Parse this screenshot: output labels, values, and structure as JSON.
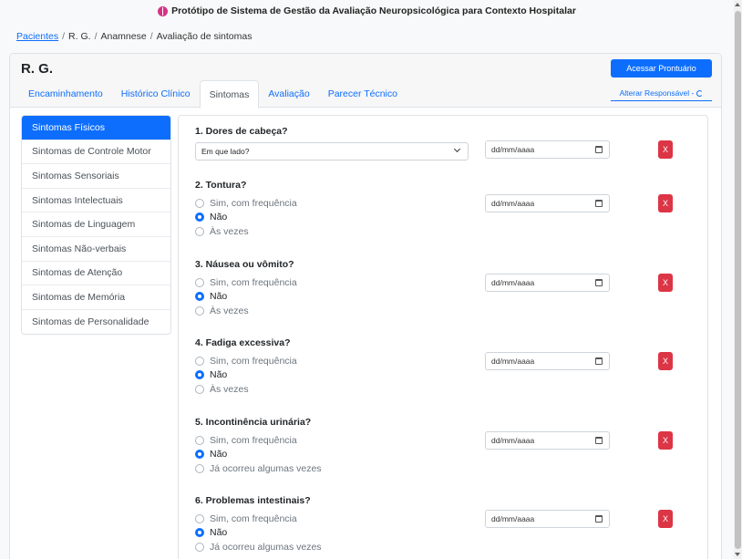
{
  "app": {
    "title": "Protótipo de Sistema de Gestão da Avaliação Neuropsicológica para Contexto Hospitalar"
  },
  "breadcrumb": {
    "items": [
      "Pacientes",
      "R. G.",
      "Anamnese",
      "Avaliação de sintomas"
    ]
  },
  "patient": {
    "name": "R. G."
  },
  "header": {
    "primary_button": "Acessar Prontuário",
    "alter_link": "Alterar Responsável -"
  },
  "tabs": [
    "Encaminhamento",
    "Histórico Clínico",
    "Sintomas",
    "Avaliação",
    "Parecer Técnico"
  ],
  "active_tab": "Sintomas",
  "sidebar": {
    "items": [
      "Sintomas Físicos",
      "Sintomas de Controle Motor",
      "Sintomas Sensoriais",
      "Sintomas Intelectuais",
      "Sintomas de Linguagem",
      "Sintomas Não-verbais",
      "Sintomas de Atenção",
      "Sintomas de Memória",
      "Sintomas de Personalidade"
    ],
    "active_index": 0
  },
  "date_placeholder": "dd/mm/aaaa",
  "delete_label": "X",
  "questions": [
    {
      "title": "1. Dores de cabeça?",
      "select_value": "Em que lado?"
    },
    {
      "title": "2. Tontura?",
      "options": [
        "Sim, com frequência",
        "Não",
        "Às vezes"
      ],
      "selected": 1
    },
    {
      "title": "3. Náusea ou vômito?",
      "options": [
        "Sim, com frequência",
        "Não",
        "Às vezes"
      ],
      "selected": 1
    },
    {
      "title": "4. Fadiga excessiva?",
      "options": [
        "Sim, com frequência",
        "Não",
        "Às vezes"
      ],
      "selected": 1
    },
    {
      "title": "5. Incontinência urinária?",
      "options": [
        "Sim, com frequência",
        "Não",
        "Já ocorreu algumas vezes"
      ],
      "selected": 1
    },
    {
      "title": "6. Problemas intestinais?",
      "options": [
        "Sim, com frequência",
        "Não",
        "Já ocorreu algumas vezes"
      ],
      "selected": 1
    }
  ]
}
